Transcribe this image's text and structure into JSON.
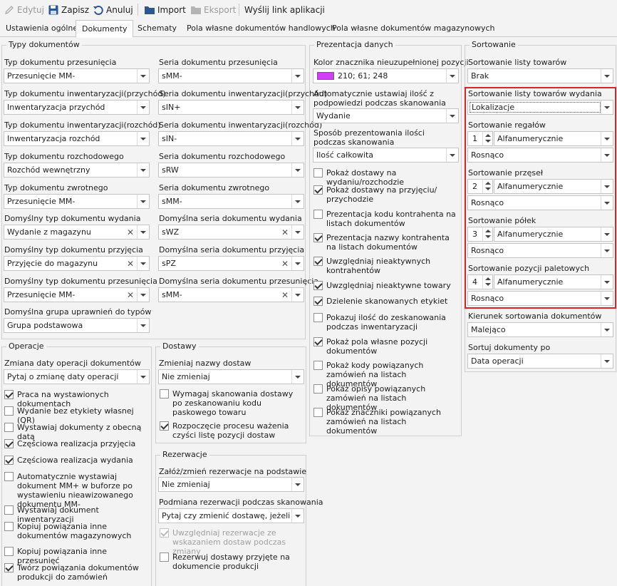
{
  "toolbar": {
    "edit": "Edytuj",
    "save": "Zapisz",
    "cancel": "Anuluj",
    "import": "Import",
    "export": "Eksport",
    "send_link": "Wyślij link aplikacji"
  },
  "tabs": [
    "Ustawienia ogólne",
    "Dokumenty",
    "Schematy",
    "Pola własne dokumentów handlowych",
    "Pola własne dokumentów magazynowych"
  ],
  "doc_types": {
    "title": "Typy dokumentów",
    "move_type_label": "Typ dokumentu przesunięcia",
    "move_type_value": "Przesunięcie MM-",
    "move_series_label": "Seria dokumentu przesunięcia",
    "move_series_value": "sMM-",
    "inv_in_type_label": "Typ dokumentu inwentaryzacji(przychód)",
    "inv_in_type_value": "Inwentaryzacja przychód",
    "inv_in_series_label": "Seria dokumentu inwentaryzacji(przychód)",
    "inv_in_series_value": "sIN+",
    "inv_out_type_label": "Typ dokumentu inwentaryzacji(rozchód)",
    "inv_out_type_value": "Inwentaryzacja rozchód",
    "inv_out_series_label": "Seria dokumentu inwentaryzacji(rozchód)",
    "inv_out_series_value": "sIN-",
    "out_type_label": "Typ dokumentu rozchodowego",
    "out_type_value": "Rozchód wewnętrzny",
    "out_series_label": "Seria dokumentu rozchodowego",
    "out_series_value": "sRW",
    "ret_type_label": "Typ dokumentu zwrotnego",
    "ret_type_value": "Przesunięcie MM-",
    "ret_series_label": "Seria dokumentu zwrotnego",
    "ret_series_value": "sMM-",
    "def_issue_type_label": "Domyślny typ dokumentu wydania",
    "def_issue_type_value": "Wydanie z magazynu",
    "def_issue_series_label": "Domyślna seria dokumentu wydania",
    "def_issue_series_value": "sWZ",
    "def_recv_type_label": "Domyślny typ dokumentu przyjęcia",
    "def_recv_type_value": "Przyjęcie do magazynu",
    "def_recv_series_label": "Domyślna seria dokumentu przyjęcia",
    "def_recv_series_value": "sPZ",
    "def_move_type_label": "Domyślny typ dokumentu przesunięcia",
    "def_move_type_value": "Przesunięcie MM-",
    "def_move_series_label": "Domyślna seria dokumentu przesunięcia",
    "def_move_series_value": "sMM-",
    "perm_group_label": "Domyślna grupa uprawnień do typów",
    "perm_group_value": "Grupa podstawowa"
  },
  "operations": {
    "title": "Operacje",
    "date_change_label": "Zmiana daty operacji dokumentów",
    "date_change_value": "Pytaj o zmianę daty operacji",
    "checks": [
      {
        "label": "Praca na wystawionych dokumentach",
        "checked": true
      },
      {
        "label": "Wydanie bez etykiety własnej (QR)",
        "checked": false
      },
      {
        "label": "Wystawiaj dokumenty z obecną datą",
        "checked": false
      },
      {
        "label": "Częściowa realizacja przyjęcia",
        "checked": true
      },
      {
        "label": "Częściowa realizacja wydania",
        "checked": true
      },
      {
        "label": "Automatycznie wystawiaj dokument MM+ w buforze po wystawieniu nieawizowanego dokumentu MM-",
        "checked": false
      },
      {
        "label": "Wystawiaj dokument inwentaryzacji",
        "checked": false
      },
      {
        "label": "Kopiuj powiązania inne dokumentów magazynowych",
        "checked": false
      },
      {
        "label": "Kopiuj powiązania inne przesunięć",
        "checked": false
      },
      {
        "label": "Twórz powiązania dokumentów produkcji do zamówień",
        "checked": true
      }
    ]
  },
  "deliveries": {
    "title": "Dostawy",
    "name_change_label": "Zmieniaj nazwy dostaw",
    "name_change_value": "Nie zmieniaj",
    "checks": [
      {
        "label": "Wymagaj skanowania dostawy po zeskanowaniu kodu paskowego towaru",
        "checked": false
      },
      {
        "label": "Rozpoczęcie procesu ważenia czyści listę pozycji dostaw",
        "checked": true
      }
    ]
  },
  "reservations": {
    "title": "Rezerwacje",
    "create_label": "Załóż/zmień rezerwacje na podstawie",
    "create_value": "Nie zmieniaj",
    "replace_label": "Podmiana rezerwacji podczas skanowania",
    "replace_value": "Pytaj czy zmienić dostawę, jeżeli ze...",
    "checks": [
      {
        "label": "Uwzględniaj rezerwacje ze wskazaniem dostaw podczas zmiany",
        "checked": true,
        "disabled": true
      },
      {
        "label": "Rezerwuj dostawy przyjęte na dokumencie produkcji",
        "checked": false,
        "disabled": false
      }
    ]
  },
  "presentation": {
    "title": "Prezentacja danych",
    "marker_color_label": "Kolor znacznika nieuzupełnionej pozycji",
    "marker_color_value": "210; 61; 248",
    "marker_color_hex": "#d23df8",
    "auto_qty_label": "Automatycznie ustawiaj ilość z podpowiedzi podczas skanowania",
    "auto_qty_value": "Wydanie",
    "qty_mode_label": "Sposób prezentowania ilości podczas skanowania",
    "qty_mode_value": "Ilość całkowita",
    "checks": [
      {
        "label": "Pokaż dostawy na wydaniu/rozchodzie",
        "checked": false
      },
      {
        "label": "Pokaż dostawy na przyjęciu/ przychodzie",
        "checked": true
      },
      {
        "label": "Prezentacja kodu kontrahenta na listach dokumentów",
        "checked": false
      },
      {
        "label": "Prezentacja nazwy kontrahenta na listach dokumentów",
        "checked": true
      },
      {
        "label": "Uwzględniaj nieaktywnych kontrahentów",
        "checked": true
      },
      {
        "label": "Uwzględniaj nieaktywne towary",
        "checked": true
      },
      {
        "label": "Dzielenie skanowanych etykiet",
        "checked": true
      },
      {
        "label": "Pokazuj ilość do zeskanowania podczas inwentaryzacji",
        "checked": false
      },
      {
        "label": "Pokaż pola własne pozycji dokumentów",
        "checked": true
      },
      {
        "label": "Pokaż kody powiązanych zamówień na listach dokumentów",
        "checked": false
      },
      {
        "label": "Pokaż opisy powiązanych zamówień na listach dokumentów",
        "checked": false
      },
      {
        "label": "Pokaż znaczniki powiązanych zamówień na listach dokumentów",
        "checked": false
      }
    ]
  },
  "sorting": {
    "title": "Sortowanie",
    "items_label": "Sortowanie listy towarów",
    "items_value": "Brak",
    "issue_items_label": "Sortowanie listy towarów wydania",
    "issue_items_value": "Lokalizacje",
    "racks_label": "Sortowanie regałów",
    "racks_num": "1",
    "racks_mode": "Alfanumerycznie",
    "racks_dir": "Rosnąco",
    "aisles_label": "Sortowanie przęseł",
    "aisles_num": "2",
    "aisles_mode": "Alfanumerycznie",
    "aisles_dir": "Rosnąco",
    "shelves_label": "Sortowanie półek",
    "shelves_num": "3",
    "shelves_mode": "Alfanumerycznie",
    "shelves_dir": "Rosnąco",
    "pallets_label": "Sortowanie pozycji paletowych",
    "pallets_num": "4",
    "pallets_mode": "Alfanumerycznie",
    "pallets_dir": "Rosnąco",
    "doc_dir_label": "Kierunek sortowania dokumentów",
    "doc_dir_value": "Malejąco",
    "doc_by_label": "Sortuj dokumenty po",
    "doc_by_value": "Data operacji"
  }
}
